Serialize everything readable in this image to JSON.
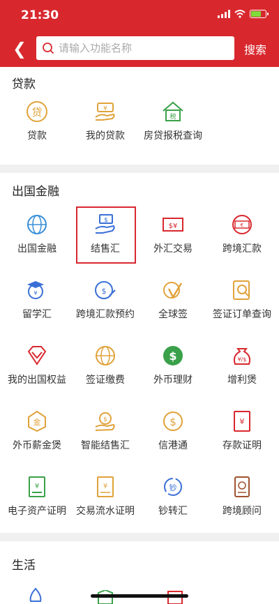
{
  "status": {
    "time": "21:30"
  },
  "header": {
    "search_placeholder": "请输入功能名称",
    "search_label": "搜索"
  },
  "sections": [
    {
      "title": "贷款",
      "items": [
        {
          "label": "贷款",
          "icon": "loan-icon",
          "color": "#e0a23a"
        },
        {
          "label": "我的贷款",
          "icon": "my-loan-icon",
          "color": "#e0a23a"
        },
        {
          "label": "房贷报税查询",
          "icon": "house-tax-icon",
          "color": "#3aa14a"
        }
      ]
    },
    {
      "title": "出国金融",
      "items": [
        {
          "label": "出国金融",
          "icon": "globe-icon",
          "color": "#3a8fd6"
        },
        {
          "label": "结售汇",
          "icon": "exchange-settlement-icon",
          "color": "#3a6fd6"
        },
        {
          "label": "外汇交易",
          "icon": "forex-trade-icon",
          "color": "#d8282e"
        },
        {
          "label": "跨境汇款",
          "icon": "cross-border-remit-icon",
          "color": "#d8282e"
        },
        {
          "label": "留学汇",
          "icon": "study-abroad-icon",
          "color": "#3a6fd6"
        },
        {
          "label": "跨境汇款预约",
          "icon": "remit-appointment-icon",
          "color": "#3a6fd6"
        },
        {
          "label": "全球签",
          "icon": "global-visa-icon",
          "color": "#e0a23a"
        },
        {
          "label": "签证订单查询",
          "icon": "visa-order-icon",
          "color": "#e0a23a"
        },
        {
          "label": "我的出国权益",
          "icon": "diamond-icon",
          "color": "#d8282e"
        },
        {
          "label": "签证缴费",
          "icon": "visa-fee-icon",
          "color": "#e0a23a"
        },
        {
          "label": "外币理财",
          "icon": "dollar-icon",
          "color": "#3aa14a"
        },
        {
          "label": "增利煲",
          "icon": "money-bag-icon",
          "color": "#d8282e"
        },
        {
          "label": "外币薪金煲",
          "icon": "salary-icon",
          "color": "#e0a23a"
        },
        {
          "label": "智能结售汇",
          "icon": "smart-exchange-icon",
          "color": "#e0a23a"
        },
        {
          "label": "信港通",
          "icon": "hk-link-icon",
          "color": "#e0a23a"
        },
        {
          "label": "存款证明",
          "icon": "deposit-cert-icon",
          "color": "#d8282e"
        },
        {
          "label": "电子资产证明",
          "icon": "asset-cert-icon",
          "color": "#3aa14a"
        },
        {
          "label": "交易流水证明",
          "icon": "transaction-cert-icon",
          "color": "#e0a23a"
        },
        {
          "label": "钞转汇",
          "icon": "cash-to-remit-icon",
          "color": "#3a6fd6"
        },
        {
          "label": "跨境顾问",
          "icon": "passport-icon",
          "color": "#a0522d"
        }
      ]
    },
    {
      "title": "生活",
      "items": []
    }
  ],
  "highlighted_item": "结售汇"
}
